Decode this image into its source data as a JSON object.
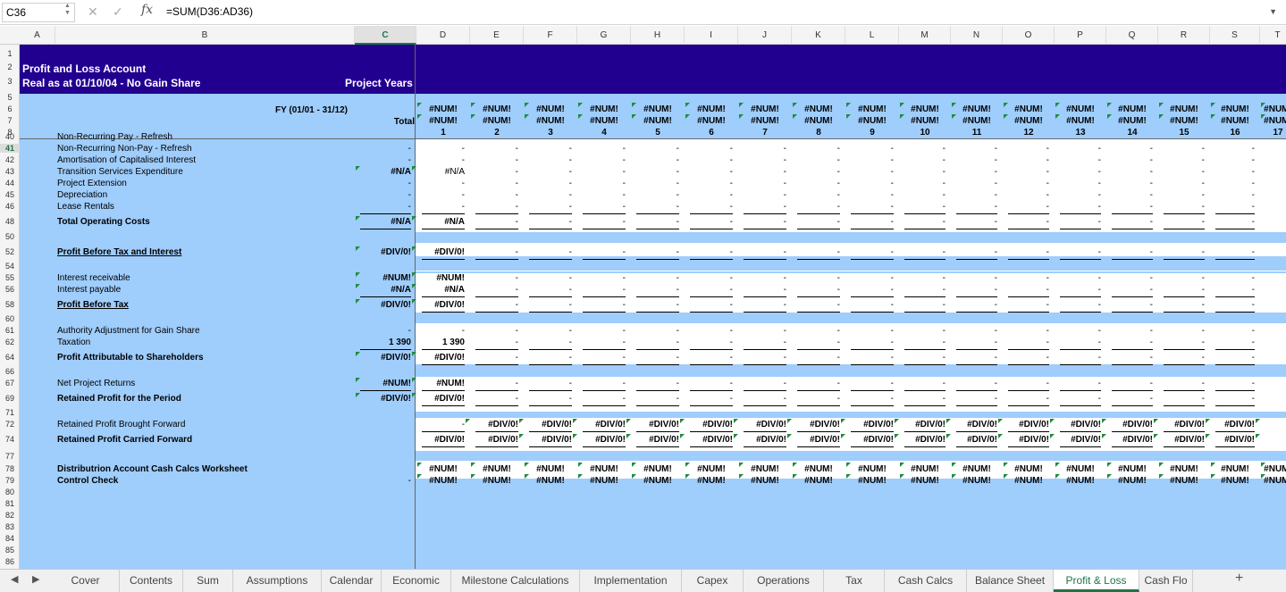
{
  "formula_bar": {
    "cell_ref": "C36",
    "fx": "fx",
    "formula": "=SUM(D36:AD36)"
  },
  "columns": [
    "A",
    "B",
    "C",
    "D",
    "E",
    "F",
    "G",
    "H",
    "I",
    "J",
    "K",
    "L",
    "M",
    "N",
    "O",
    "P",
    "Q",
    "R",
    "S",
    "T"
  ],
  "selected_column": "C",
  "rows": [
    "1",
    "2",
    "3",
    "5",
    "6",
    "7",
    "8",
    "40",
    "41",
    "42",
    "43",
    "44",
    "45",
    "46",
    "48",
    "50",
    "52",
    "54",
    "55",
    "56",
    "58",
    "60",
    "61",
    "62",
    "64",
    "66",
    "67",
    "69",
    "71",
    "72",
    "74",
    "77",
    "78",
    "79",
    "80",
    "81",
    "82",
    "83",
    "84",
    "85",
    "86"
  ],
  "header": {
    "title": "Profit and Loss Account",
    "subtitle": "Real as at 01/10/04 - No Gain Share",
    "project_years": "Project Years",
    "fy": "FY  (01/01 -  31/12)",
    "total": "Total",
    "num_err": "#NUM!",
    "year_numbers": [
      "1",
      "2",
      "3",
      "4",
      "5",
      "6",
      "7",
      "8",
      "9",
      "10",
      "11",
      "12",
      "13",
      "14",
      "15",
      "16",
      "17"
    ]
  },
  "lines": {
    "r40": "Non-Recurring Pay - Refresh",
    "r41": "Non-Recurring Non-Pay - Refresh",
    "r42": "Amortisation of Capitalised Interest",
    "r43": "Transition Services Expenditure",
    "r44": "Project Extension",
    "r45": "Depreciation",
    "r46": "Lease Rentals",
    "r48": "Total Operating Costs",
    "r52": "Profit Before Tax and Interest",
    "r55": "Interest receivable",
    "r56": "Interest payable",
    "r58": "Profit Before Tax",
    "r61": "Authority Adjustment for Gain Share",
    "r62": "Taxation",
    "r64": "Profit Attributable to Shareholders",
    "r67": "Net Project Returns",
    "r69": "Retained Profit for the Period",
    "r72": "Retained Profit Brought Forward",
    "r74": "Retained Profit Carried Forward",
    "r78": "Distributrion Account Cash Calcs Worksheet",
    "r79": "Control Check"
  },
  "values": {
    "dash": "-",
    "na": "#N/A",
    "div0": "#DIV/0!",
    "num": "#NUM!",
    "taxation": "1 390"
  },
  "tabs": [
    "Cover",
    "Contents",
    "Sum",
    "Assumptions",
    "Calendar",
    "Economic",
    "Milestone Calculations",
    "Implementation",
    "Capex",
    "Operations",
    "Tax",
    "Cash Calcs",
    "Balance Sheet",
    "Profit & Loss",
    "Cash Flo"
  ],
  "active_tab": "Profit & Loss",
  "colors": {
    "title_band": "#21008f",
    "body": "#9fcdfc",
    "accent": "#217346"
  }
}
